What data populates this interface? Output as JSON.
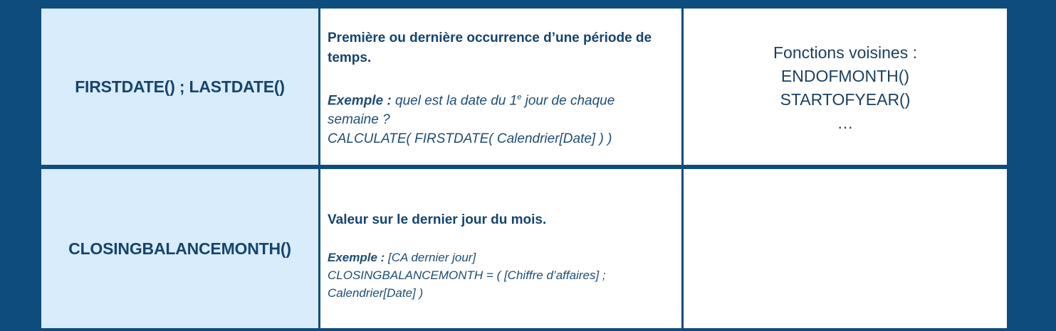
{
  "rows": [
    {
      "name": "FIRSTDATE() ; LASTDATE()",
      "title_line1": "Première ou dernière occurrence d’une période de",
      "title_line2": "temps.",
      "example_label": "Exemple :",
      "example_text_a": " quel est la date du 1",
      "example_sup": "e",
      "example_text_b": " jour de chaque",
      "example_line2": "semaine ?",
      "example_line3": "CALCULATE( FIRSTDATE( Calendrier[Date] ) )",
      "related_title": "Fonctions voisines :",
      "related": [
        "ENDOFMONTH()",
        "STARTOFYEAR()",
        "…"
      ]
    },
    {
      "name": "CLOSINGBALANCEMONTH()",
      "title": "Valeur sur le dernier jour du mois.",
      "example_label": "Exemple :",
      "example_line1": " [CA dernier jour]",
      "example_line2": "CLOSINGBALANCEMONTH = ( [Chiffre d’affaires] ;",
      "example_line3": "Calendrier[Date] )"
    }
  ]
}
